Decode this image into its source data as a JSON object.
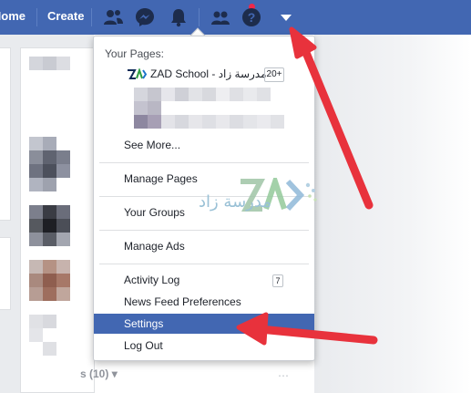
{
  "topbar": {
    "home_label": "Home",
    "create_label": "Create",
    "icons": [
      "friends-icon",
      "messenger-icon",
      "notifications-icon",
      "find-friends-icon",
      "help-icon",
      "caret-down-icon"
    ]
  },
  "dropdown": {
    "section_heading": "Your Pages:",
    "page": {
      "name": "ZAD School - مدرسة زاد",
      "notification_count": "20+"
    },
    "see_more": "See More...",
    "items": {
      "manage_pages": "Manage Pages",
      "your_groups": "Your Groups",
      "manage_ads": "Manage Ads",
      "activity_log": "Activity Log",
      "activity_log_count": "7",
      "news_feed_prefs": "News Feed Preferences",
      "settings": "Settings",
      "log_out": "Log Out"
    }
  },
  "background": {
    "bottom_text": "s (10)"
  },
  "watermark": {
    "arabic_text": "مدرسة زاد"
  },
  "colors": {
    "brand": "#4267b2",
    "highlight": "#4267b2",
    "annotation_arrow": "#e8323c"
  }
}
